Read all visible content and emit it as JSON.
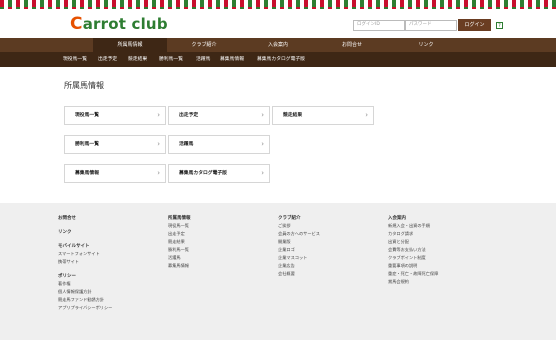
{
  "brand": {
    "logo_first": "C",
    "logo_rest": "arrot club"
  },
  "login": {
    "id_placeholder": "ログインID",
    "pw_placeholder": "パスワード",
    "button": "ログイン",
    "help": "?"
  },
  "mainnav": [
    "所属馬情報",
    "クラブ紹介",
    "入会案内",
    "お問合せ",
    "リンク"
  ],
  "subnav": [
    "現役馬一覧",
    "出走予定",
    "競走結果",
    "勝利馬一覧",
    "活躍馬",
    "募集馬情報",
    "募集馬カタログ電子版"
  ],
  "page_title": "所属馬情報",
  "cards": [
    "現役馬一覧",
    "出走予定",
    "競走結果",
    "勝利馬一覧",
    "活躍馬",
    "募集馬情報",
    "募集馬カタログ電子版"
  ],
  "footer": {
    "col1": {
      "groups": [
        {
          "head": "お問合せ",
          "links": []
        },
        {
          "head": "リンク",
          "links": []
        },
        {
          "head": "モバイルサイト",
          "links": [
            "スマートフォンサイト",
            "携帯サイト"
          ]
        },
        {
          "head": "ポリシー",
          "links": [
            "著作権",
            "個人情報保護方針",
            "競走馬ファンド勧誘方針",
            "アプリプライバシーポリシー"
          ]
        }
      ]
    },
    "col2": {
      "head": "所属馬情報",
      "links": [
        "現役馬一覧",
        "出走予定",
        "競走結果",
        "勝利馬一覧",
        "活躍馬",
        "募集馬情報"
      ]
    },
    "col3": {
      "head": "クラブ紹介",
      "links": [
        "ご挨拶",
        "会員の方へのサービス",
        "開業版",
        "企業ロゴ",
        "企業マスコット",
        "企業広告",
        "会社概要"
      ]
    },
    "col4": {
      "head": "入会案内",
      "links": [
        "新規入会・出資の手順",
        "カタログ請求",
        "出資と分配",
        "会費等お支払い方法",
        "クラブポイント制度",
        "重要事項の説明",
        "重症・死亡・故障死亡保障",
        "賞馬会規約"
      ]
    }
  }
}
